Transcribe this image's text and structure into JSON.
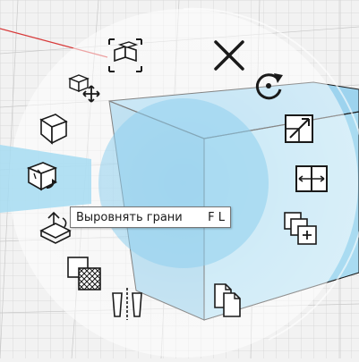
{
  "tooltip": {
    "label": "Выровнять грани",
    "shortcut": "F L"
  },
  "colors": {
    "accent": "#a6dcf2",
    "cube_face": "#c5e4f1",
    "ring": "#ffffff",
    "grid_line": "#cccccc",
    "x_axis": "#d83a3a",
    "icon_stroke": "#1a1a1a"
  },
  "tools": [
    {
      "name": "box-select-tool",
      "icon": "box-select-icon",
      "selected": false
    },
    {
      "name": "close-menu",
      "icon": "close-icon",
      "selected": false
    },
    {
      "name": "move-tool",
      "icon": "move-arrows-icon",
      "selected": false
    },
    {
      "name": "rotate-tool",
      "icon": "rotate-icon",
      "selected": false
    },
    {
      "name": "pull-tool",
      "icon": "box-face-icon",
      "selected": false
    },
    {
      "name": "scale-tool",
      "icon": "scale-icon",
      "selected": false
    },
    {
      "name": "align-faces-tool",
      "icon": "align-faces-icon",
      "selected": true
    },
    {
      "name": "split-tool",
      "icon": "split-icon",
      "selected": false
    },
    {
      "name": "combine-tool",
      "icon": "combine-icon",
      "selected": false
    },
    {
      "name": "offset-tool",
      "icon": "offset-icon",
      "selected": false
    },
    {
      "name": "copy-tool",
      "icon": "copy-icon",
      "selected": false
    },
    {
      "name": "pattern-tool",
      "icon": "pattern-icon",
      "selected": false
    },
    {
      "name": "mirror-tool",
      "icon": "mirror-icon",
      "selected": false
    }
  ]
}
